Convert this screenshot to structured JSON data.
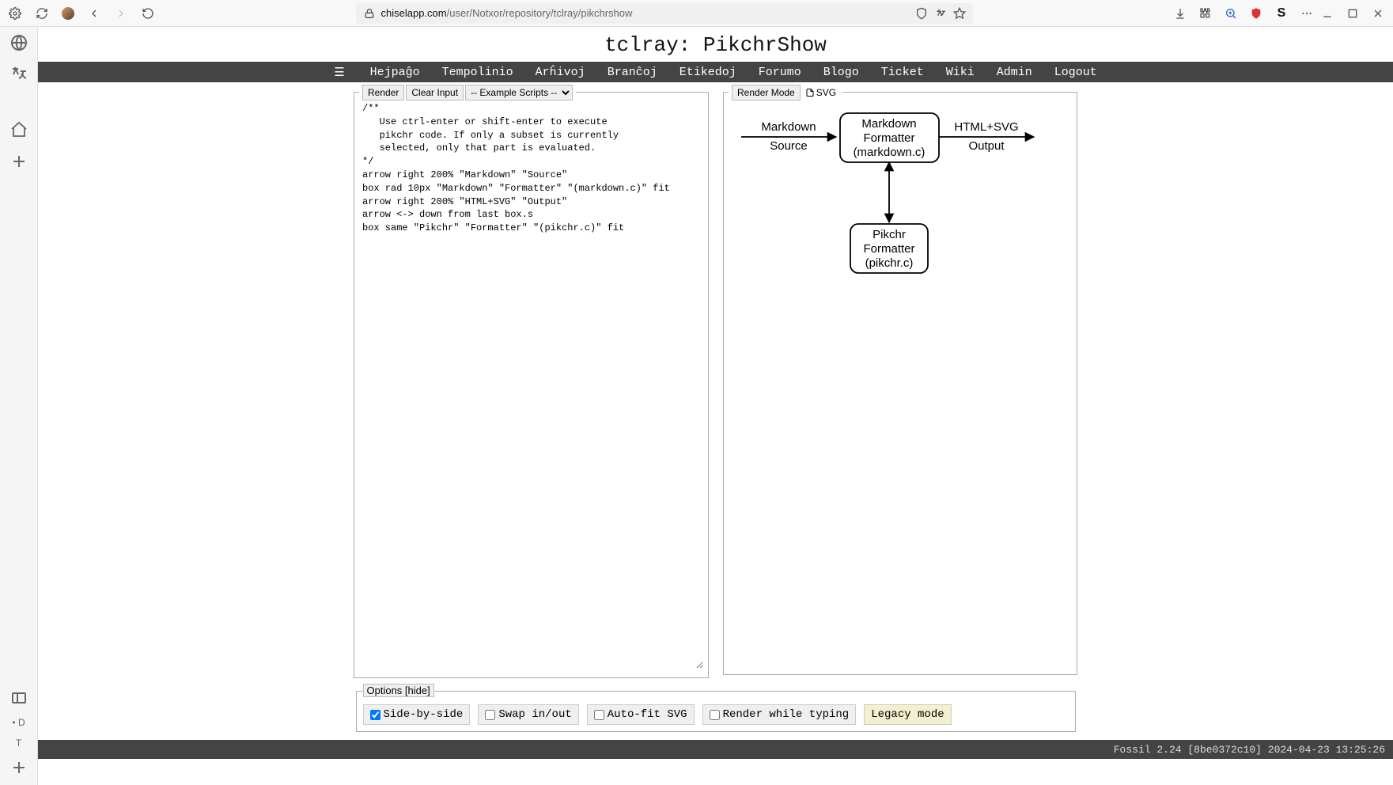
{
  "browser": {
    "url_host": "chiselapp.com",
    "url_path": "/user/Notxor/repository/tclray/pikchrshow"
  },
  "sidebar_letters": {
    "d": "D",
    "t": "T"
  },
  "page_title": "tclray: PikchrShow",
  "nav": {
    "hamburger": "☰",
    "items": [
      "Hejpaĝo",
      "Tempolinio",
      "Arĥivoj",
      "Branĉoj",
      "Etikedoj",
      "Forumo",
      "Blogo",
      "Ticket",
      "Wiki",
      "Admin",
      "Logout"
    ]
  },
  "input_panel": {
    "render": "Render",
    "clear": "Clear Input",
    "select": "-- Example Scripts --",
    "code": "/**\n   Use ctrl-enter or shift-enter to execute\n   pikchr code. If only a subset is currently\n   selected, only that part is evaluated.\n*/\narrow right 200% \"Markdown\" \"Source\"\nbox rad 10px \"Markdown\" \"Formatter\" \"(markdown.c)\" fit\narrow right 200% \"HTML+SVG\" \"Output\"\narrow <-> down from last box.s\nbox same \"Pikchr\" \"Formatter\" \"(pikchr.c)\" fit"
  },
  "output_panel": {
    "render_mode": "Render Mode",
    "svg_label": "SVG"
  },
  "diagram": {
    "arrow1": {
      "line1": "Markdown",
      "line2": "Source"
    },
    "box1": {
      "line1": "Markdown",
      "line2": "Formatter",
      "line3": "(markdown.c)"
    },
    "arrow2": {
      "line1": "HTML+SVG",
      "line2": "Output"
    },
    "box2": {
      "line1": "Pikchr",
      "line2": "Formatter",
      "line3": "(pikchr.c)"
    }
  },
  "options": {
    "legend": "Options [hide]",
    "side_by_side": "Side-by-side",
    "swap": "Swap in/out",
    "autofit": "Auto-fit SVG",
    "rwt": "Render while typing",
    "legacy": "Legacy mode"
  },
  "footer": "Fossil 2.24 [8be0372c10] 2024-04-23 13:25:26"
}
